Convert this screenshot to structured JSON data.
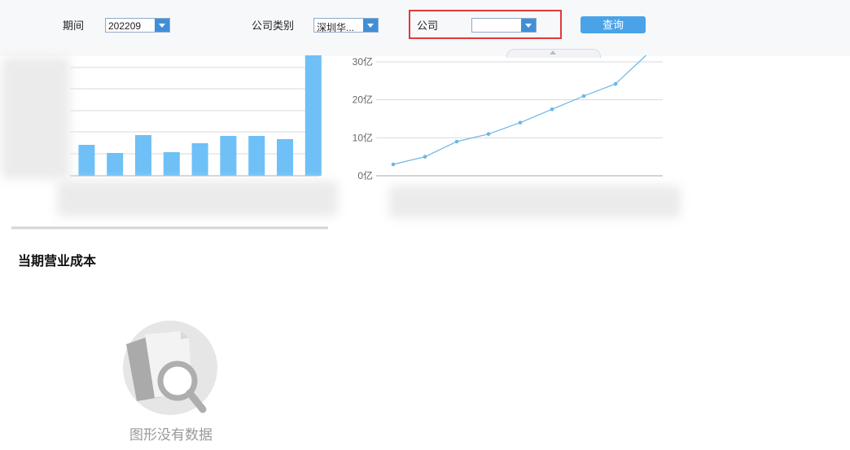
{
  "toolbar": {
    "period_label": "期间",
    "period_value": "202209",
    "company_type_label": "公司类别",
    "company_type_value": "深圳华...",
    "company_label": "公司",
    "company_value": "",
    "query_label": "查询"
  },
  "section": {
    "title": "当期营业成本"
  },
  "empty_state": {
    "text": "图形没有数据",
    "icon": "no-data-search-icon"
  },
  "colors": {
    "bar": "#6ec0f7",
    "line": "#6ab7e6",
    "button": "#4aa3e8",
    "highlight": "#e0393b"
  },
  "chart_data": [
    {
      "type": "bar",
      "values": [
        38,
        28,
        50,
        29,
        40,
        49,
        49,
        45,
        148
      ],
      "grid": true
    },
    {
      "type": "line",
      "y_ticks": [
        "0亿",
        "10亿",
        "20亿",
        "30亿"
      ],
      "ylim": [
        0,
        30
      ],
      "values": [
        3,
        5,
        9,
        11,
        14,
        17.5,
        21,
        24.2,
        32
      ],
      "grid": true
    }
  ]
}
